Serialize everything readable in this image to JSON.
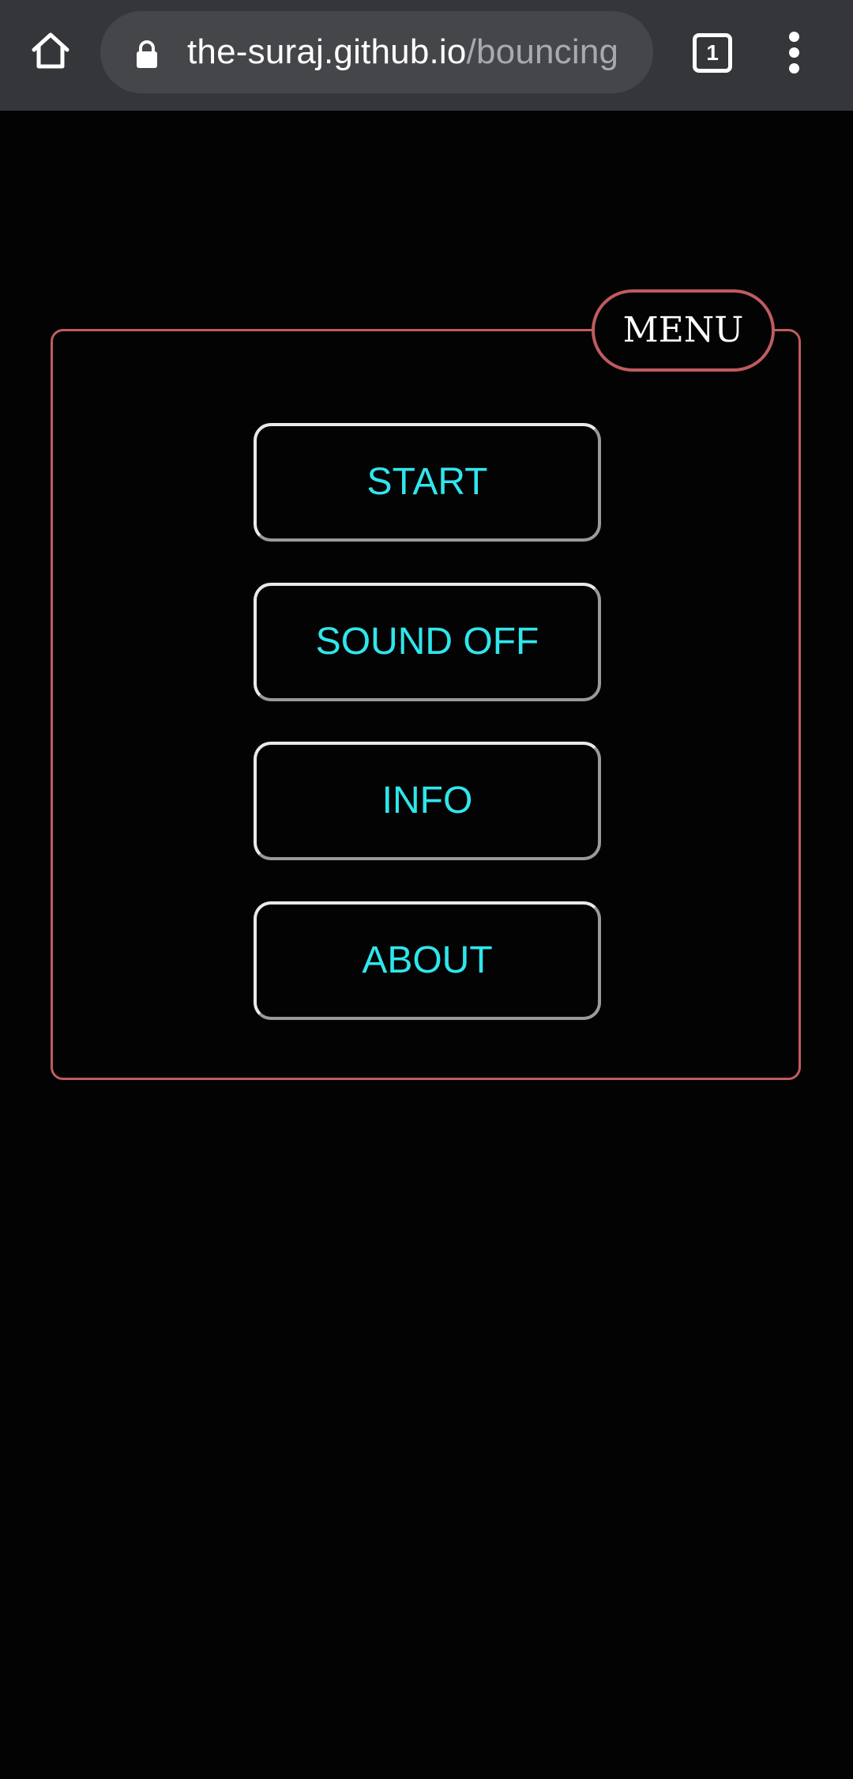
{
  "browser": {
    "url_host": "the-suraj.github.io",
    "url_path": "/bouncing",
    "tab_count": "1",
    "toolbar_color": "#35363a"
  },
  "menu": {
    "title": "MENU",
    "border_color": "#c05b5f",
    "label_color": "#2fe6ec",
    "buttons": [
      {
        "label": "START"
      },
      {
        "label": "SOUND OFF"
      },
      {
        "label": "INFO"
      },
      {
        "label": "ABOUT"
      }
    ]
  },
  "icons": {
    "home": "home-icon",
    "lock": "lock-icon",
    "tabs": "tab-switcher-icon",
    "more": "more-vert-icon"
  }
}
